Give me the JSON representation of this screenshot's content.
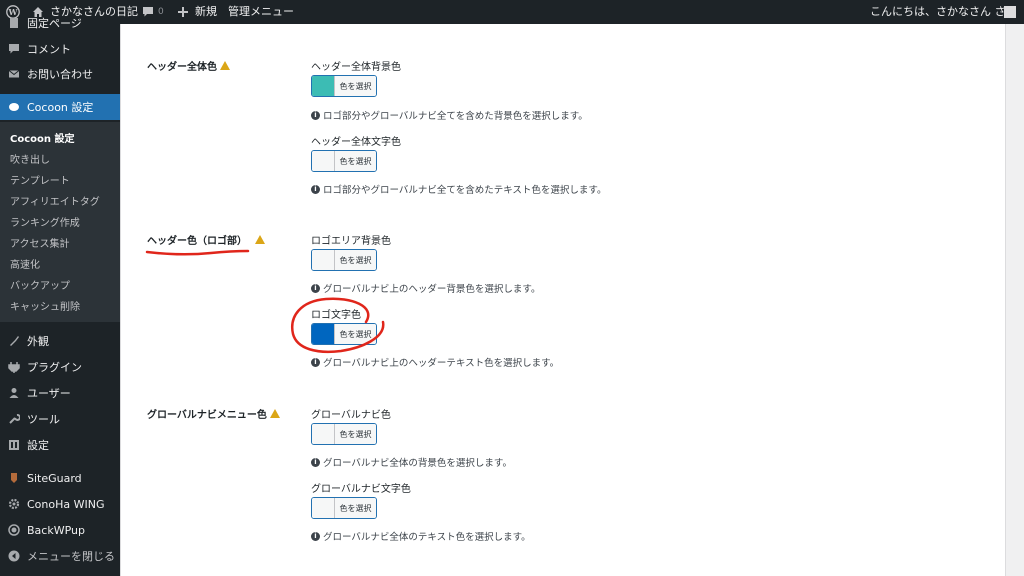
{
  "adminbar": {
    "site_name": "さかなさんの日記",
    "comments_count": "0",
    "new_label": "新規",
    "admin_menu_label": "管理メニュー",
    "greeting": "こんにちは、さかなさん さん"
  },
  "sidebar": {
    "top_partial": "固定ページ",
    "comments": "コメント",
    "contact": "お問い合わせ",
    "cocoon": "Cocoon 設定",
    "submenu": [
      "Cocoon 設定",
      "吹き出し",
      "テンプレート",
      "アフィリエイトタグ",
      "ランキング作成",
      "アクセス集計",
      "高速化",
      "バックアップ",
      "キャッシュ削除"
    ],
    "appearance": "外観",
    "plugins": "プラグイン",
    "users": "ユーザー",
    "tools": "ツール",
    "settings": "設定",
    "siteguard": "SiteGuard",
    "conoha": "ConoHa WING",
    "backwpup": "BackWPup",
    "collapse": "メニューを閉じる"
  },
  "sections": {
    "header_all": {
      "label": "ヘッダー全体色",
      "bg_label": "ヘッダー全体背景色",
      "bg_desc": "ロゴ部分やグローバルナビ全てを含めた背景色を選択します。",
      "text_label": "ヘッダー全体文字色",
      "text_desc": "ロゴ部分やグローバルナビ全てを含めたテキスト色を選択します。"
    },
    "header_logo": {
      "label": "ヘッダー色（ロゴ部）",
      "bg_label": "ロゴエリア背景色",
      "bg_desc": "グローバルナビ上のヘッダー背景色を選択します。",
      "text_label": "ロゴ文字色",
      "text_desc": "グローバルナビ上のヘッダーテキスト色を選択します。"
    },
    "global_nav": {
      "label": "グローバルナビメニュー色",
      "bg_label": "グローバルナビ色",
      "bg_desc": "グローバルナビ全体の背景色を選択します。",
      "text_label": "グローバルナビ文字色",
      "text_desc": "グローバルナビ全体のテキスト色を選択します。"
    }
  },
  "color_button_label": "色を選択",
  "colors": {
    "header_all_bg": "#3cbcb4",
    "empty_swatch": "#f6f7f7",
    "logo_text": "#0066bf",
    "annotation_red": "#e0261b",
    "accent": "#2271b1"
  }
}
